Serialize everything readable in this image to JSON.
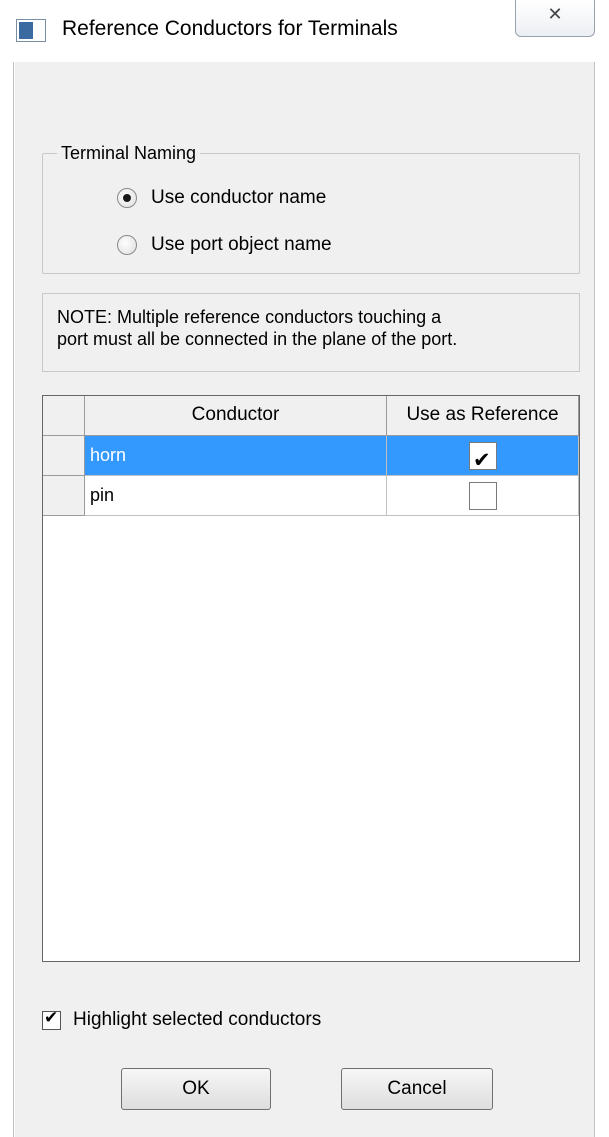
{
  "window": {
    "title": "Reference Conductors for Terminals",
    "close_glyph": "✕"
  },
  "terminal_naming": {
    "legend": "Terminal Naming",
    "options": [
      {
        "label": "Use conductor name",
        "selected": true
      },
      {
        "label": "Use port object name",
        "selected": false
      }
    ]
  },
  "note": {
    "line1": "NOTE: Multiple reference conductors touching a",
    "line2": "port must all be connected in the plane of the port."
  },
  "table": {
    "headers": [
      "Conductor",
      "Use as Reference"
    ],
    "rows": [
      {
        "conductor": "horn",
        "use_as_reference": true,
        "selected": true
      },
      {
        "conductor": "pin",
        "use_as_reference": false,
        "selected": false
      }
    ]
  },
  "highlight": {
    "label": "Highlight selected conductors",
    "checked": true
  },
  "buttons": {
    "ok": "OK",
    "cancel": "Cancel"
  },
  "colors": {
    "selection": "#3399ff",
    "dialog_bg": "#f0f0f0"
  },
  "icons": [
    "app-icon",
    "close-icon",
    "checkmark-icon"
  ]
}
